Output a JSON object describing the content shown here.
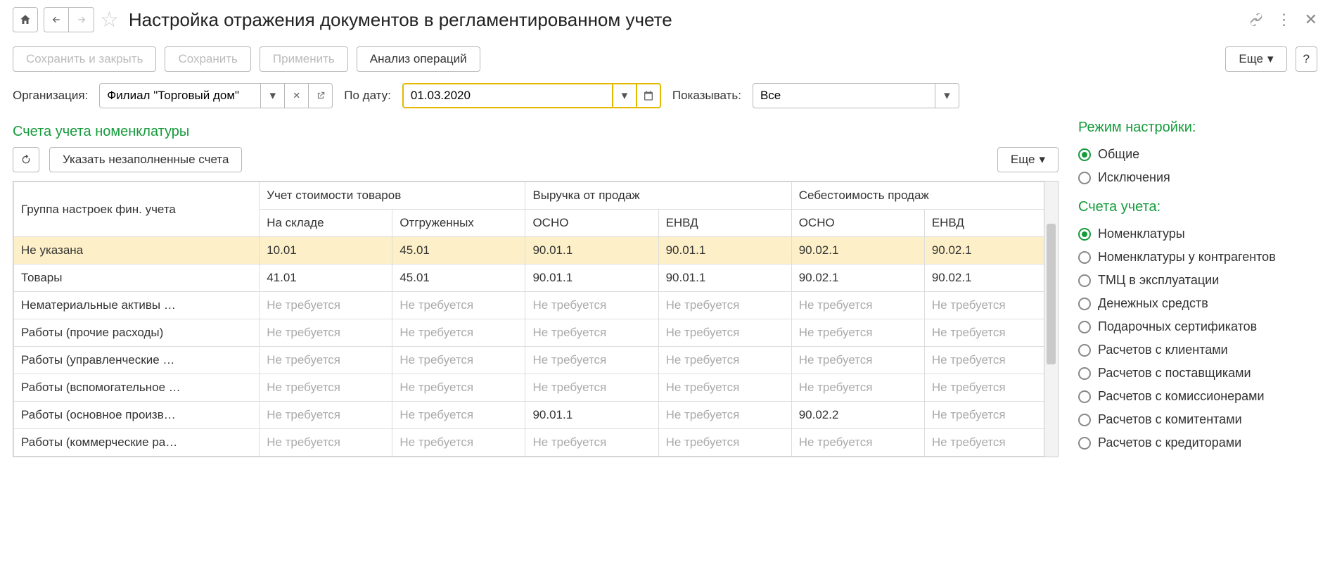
{
  "title": "Настройка отражения документов в регламентированном учете",
  "actions": {
    "save_close": "Сохранить и закрыть",
    "save": "Сохранить",
    "apply": "Применить",
    "analyze": "Анализ операций",
    "more": "Еще",
    "help": "?"
  },
  "filters": {
    "org_label": "Организация:",
    "org_value": "Филиал \"Торговый дом\"",
    "date_label": "По дату:",
    "date_value": "01.03.2020",
    "show_label": "Показывать:",
    "show_value": "Все"
  },
  "section_accounts_title": "Счета учета номенклатуры",
  "sub_actions": {
    "refresh": "⟳",
    "fill_unfilled": "Указать незаполненные счета",
    "more": "Еще"
  },
  "table": {
    "col_group": "Группа настроек фин. учета",
    "col_cost": "Учет стоимости товаров",
    "col_cost_stock": "На складе",
    "col_cost_shipped": "Отгруженных",
    "col_rev": "Выручка от продаж",
    "col_rev_osno": "ОСНО",
    "col_rev_envd": "ЕНВД",
    "col_cogs": "Себестоимость продаж",
    "col_cogs_osno": "ОСНО",
    "col_cogs_envd": "ЕНВД",
    "not_required": "Не требуется",
    "rows": [
      {
        "group": "Не указана",
        "stock": "10.01",
        "shipped": "45.01",
        "rev_osno": "90.01.1",
        "rev_envd": "90.01.1",
        "cogs_osno": "90.02.1",
        "cogs_envd": "90.02.1",
        "sel": true
      },
      {
        "group": "Товары",
        "stock": "41.01",
        "shipped": "45.01",
        "rev_osno": "90.01.1",
        "rev_envd": "90.01.1",
        "cogs_osno": "90.02.1",
        "cogs_envd": "90.02.1"
      },
      {
        "group": "Нематериальные активы …",
        "nr": true
      },
      {
        "group": "Работы (прочие расходы)",
        "nr": true
      },
      {
        "group": "Работы (управленческие …",
        "nr": true
      },
      {
        "group": "Работы (вспомогательное …",
        "nr": true
      },
      {
        "group": "Работы (основное произв…",
        "stock": "",
        "shipped": "",
        "rev_osno": "90.01.1",
        "rev_envd": "",
        "cogs_osno": "90.02.2",
        "cogs_envd": "",
        "partial": true
      },
      {
        "group": "Работы (коммерческие ра…",
        "nr": true
      }
    ]
  },
  "right": {
    "mode_title": "Режим настройки:",
    "mode_options": [
      "Общие",
      "Исключения"
    ],
    "mode_selected": 0,
    "accounts_title": "Счета учета:",
    "accounts_options": [
      "Номенклатуры",
      "Номенклатуры у контрагентов",
      "ТМЦ в эксплуатации",
      "Денежных средств",
      "Подарочных сертификатов",
      "Расчетов с клиентами",
      "Расчетов с поставщиками",
      "Расчетов с комиссионерами",
      "Расчетов с комитентами",
      "Расчетов с кредиторами"
    ],
    "accounts_selected": 0
  }
}
